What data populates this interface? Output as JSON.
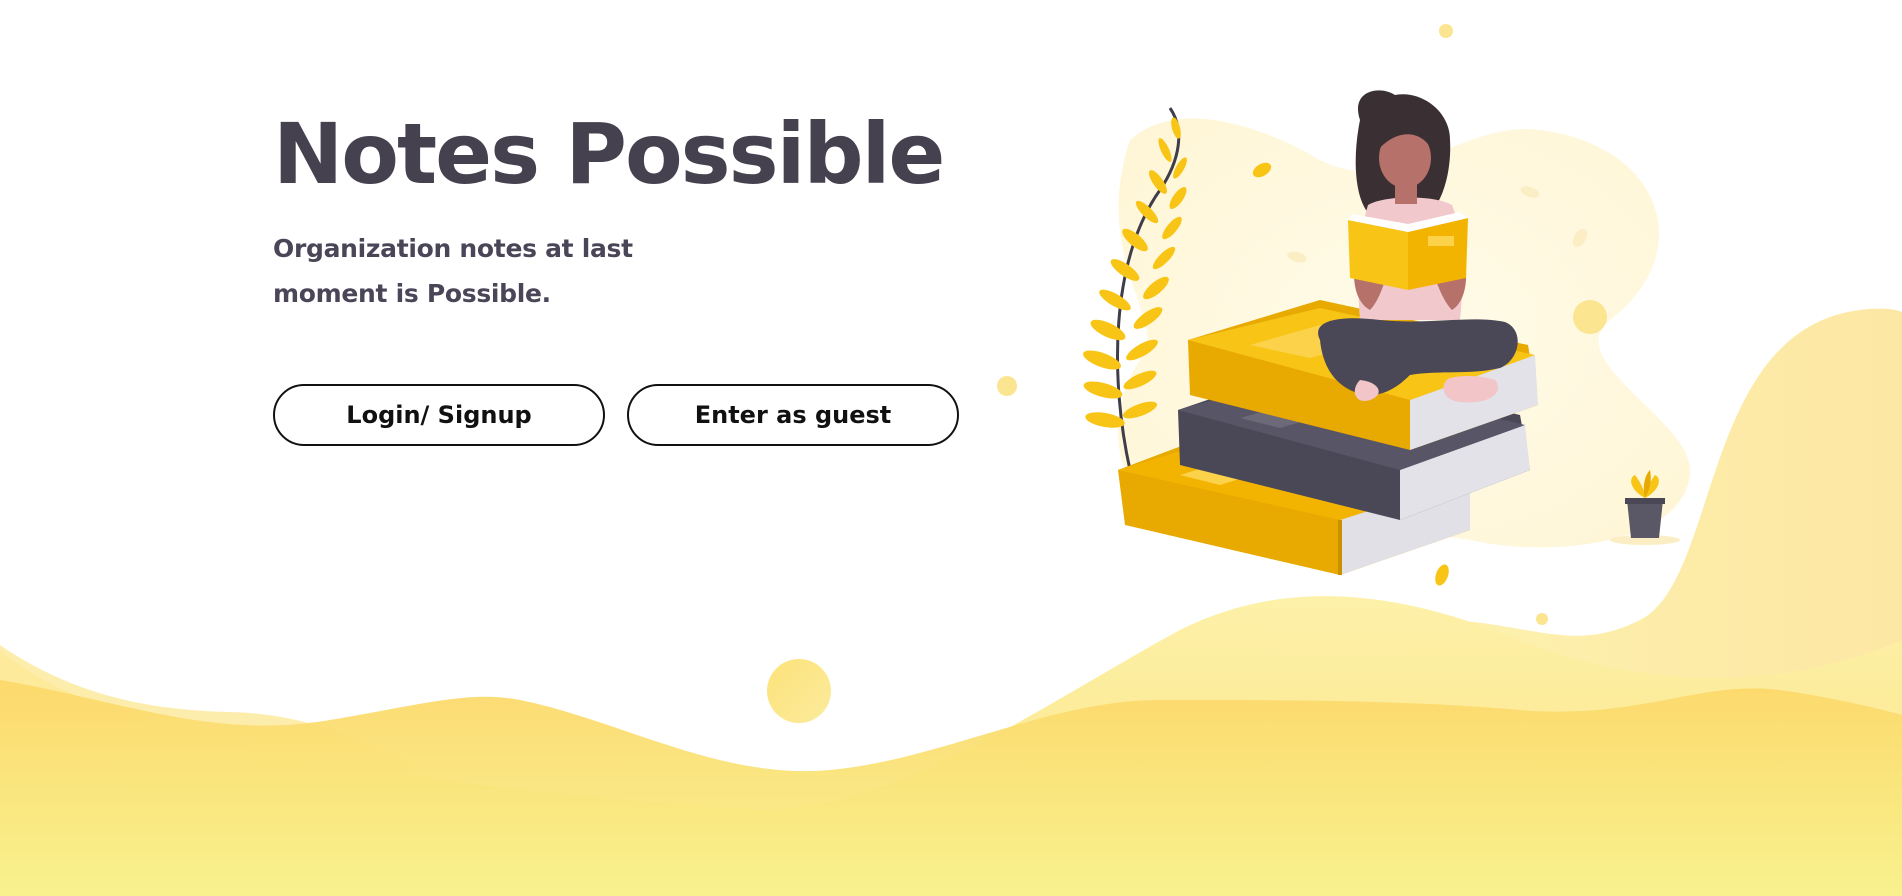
{
  "hero": {
    "title": "Notes Possible",
    "subtitle": "Organization notes at last moment is Possible."
  },
  "buttons": {
    "login_label": "Login/ Signup",
    "guest_label": "Enter as guest"
  },
  "colors": {
    "title": "#45414f",
    "accent_yellow": "#f8c516",
    "wave_light": "#faf1a6",
    "wave_mid": "#fbe07a",
    "book_dark": "#4a4757"
  },
  "illustration": {
    "subject": "woman-reading-on-books"
  }
}
